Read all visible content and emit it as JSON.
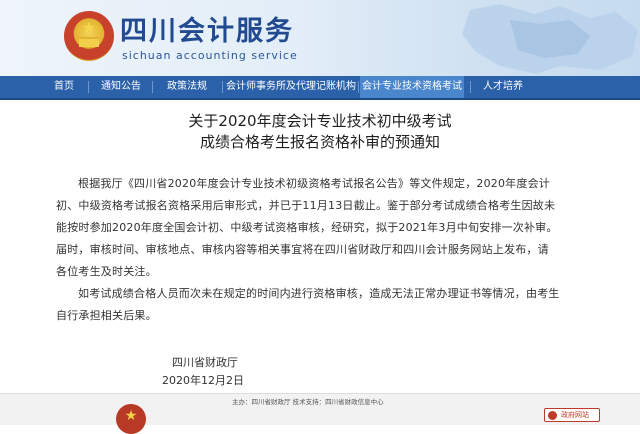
{
  "header": {
    "site_title": "四川会计服务",
    "site_subtitle": "sichuan accounting service"
  },
  "nav": {
    "items": [
      {
        "label": "首页"
      },
      {
        "label": "通知公告"
      },
      {
        "label": "政策法规"
      },
      {
        "label": "会计师事务所及代理记账机构"
      },
      {
        "label": "会计专业技术资格考试"
      },
      {
        "label": "人才培养"
      }
    ],
    "active_index": 4
  },
  "article": {
    "title_line1": "关于2020年度会计专业技术初中级考试",
    "title_line2": "成绩合格考生报名资格补审的预通知",
    "paragraph1": [
      "根据我厅《四川省2020年度会计专业技术初级资格考试报名公告》等文件规定，2020年度会计",
      "初、中级资格考试报名资格采用后审形式，并已于11月13日截止。鉴于部分考试成绩合格考生因故未",
      "能按时参加2020年度全国会计初、中级考试资格审核，经研究，拟于2021年3月中旬安排一次补审。",
      "届时，审核时间、审核地点、审核内容等相关事宜将在四川省财政厅和四川会计服务网站上发布，请",
      "各位考生及时关注。"
    ],
    "paragraph2": [
      "如考试成绩合格人员而次未在规定的时间内进行资格审核，造成无法正常办理证书等情况，由考生",
      "自行承担相关后果。"
    ],
    "signature_org": "四川省财政厅",
    "signature_date": "2020年12月2日"
  },
  "footer": {
    "text_line1": "主办：四川省财政厅  技术支持：四川省财政信息中心",
    "badge_label": "政府网站"
  }
}
